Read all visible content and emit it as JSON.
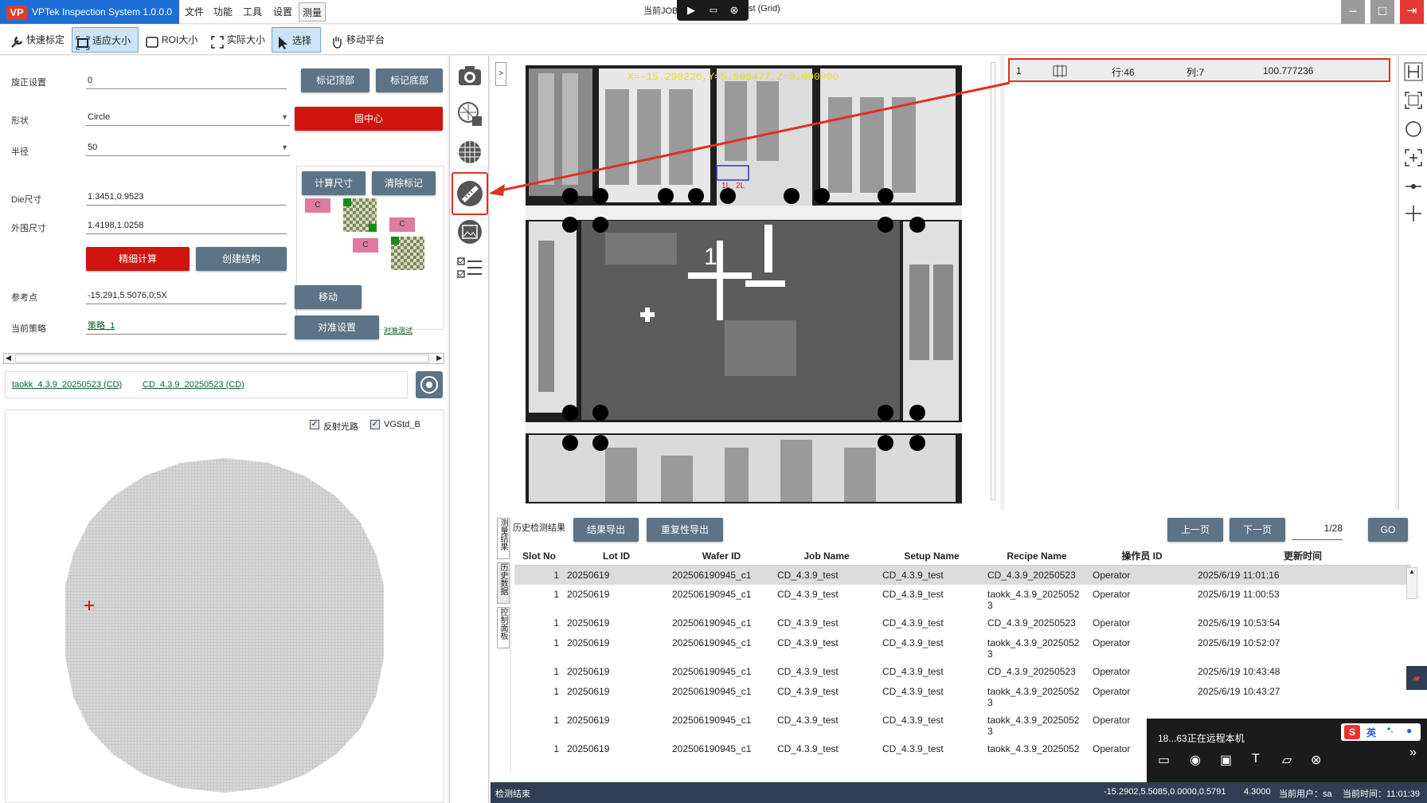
{
  "app": {
    "title": "VPTek Inspection System 1.0.0.0",
    "logo": "VP"
  },
  "menu": [
    "文件",
    "功能",
    "工具",
    "设置",
    "测量"
  ],
  "window_title": {
    "left": "当前JOB",
    "right": "st (Grid)"
  },
  "toolbar": {
    "items": [
      "快速标定",
      "适应大小",
      "ROI大小",
      "实际大小",
      "选择",
      "移动平台"
    ]
  },
  "form": {
    "rotate_label": "旋正设置",
    "rotate_value": "0",
    "mark_top": "标记顶部",
    "mark_bottom": "标记底部",
    "shape_label": "形状",
    "shape_value": "Circle",
    "circle_center": "圆中心",
    "radius_label": "半径",
    "radius_value": "50",
    "calc_size": "计算尺寸",
    "clear_mark": "清除标记",
    "die_label": "Die尺寸",
    "die_value": "1.3451,0.9523",
    "outer_label": "外围尺寸",
    "outer_value": "1.4198,1.0258",
    "fine_calc": "精细计算",
    "create_struct": "创建结构",
    "ref_label": "参考点",
    "ref_value": "-15.291,5.5076,0;5X",
    "move": "移动",
    "strategy_label": "当前策略",
    "strategy_value": "策略_1",
    "align_settings": "对准设置",
    "align_test": "对准测试",
    "tag_c": "C"
  },
  "recipes": {
    "link1": "taokk_4.3.9_20250523 (CD)",
    "link2": "CD_4.3.9_20250523 (CD)"
  },
  "wafer": {
    "check1": "反射光路",
    "check2": "VGStd_B"
  },
  "image": {
    "coord_text": "X=-15.290226,Y=5.508477,Z=0.000000",
    "expand": ">",
    "mark1": "1L",
    "mark2": "2L",
    "die_num": "1"
  },
  "result_row": {
    "index": "1",
    "row": "行:46",
    "col": "列:7",
    "value": "100.777236"
  },
  "history": {
    "title": "历史检测结果",
    "export": "结果导出",
    "repeat_export": "重复性导出",
    "prev": "上一页",
    "next": "下一页",
    "page": "1/28",
    "go": "GO",
    "vtabs": [
      "测量结果",
      "历史数据",
      "控制面板"
    ],
    "columns": [
      "Slot No",
      "Lot ID",
      "Wafer ID",
      "Job Name",
      "Setup Name",
      "Recipe Name",
      "操作员 ID",
      "更新时间"
    ],
    "rows": [
      [
        "1",
        "20250619",
        "202506190945_c1",
        "CD_4.3.9_test",
        "CD_4.3.9_test",
        "CD_4.3.9_20250523",
        "Operator",
        "2025/6/19 11:01:16"
      ],
      [
        "1",
        "20250619",
        "202506190945_c1",
        "CD_4.3.9_test",
        "CD_4.3.9_test",
        "taokk_4.3.9_2025052\n3",
        "Operator",
        "2025/6/19 11:00:53"
      ],
      [
        "1",
        "20250619",
        "202506190945_c1",
        "CD_4.3.9_test",
        "CD_4.3.9_test",
        "CD_4.3.9_20250523",
        "Operator",
        "2025/6/19 10:53:54"
      ],
      [
        "1",
        "20250619",
        "202506190945_c1",
        "CD_4.3.9_test",
        "CD_4.3.9_test",
        "taokk_4.3.9_2025052\n3",
        "Operator",
        "2025/6/19 10:52:07"
      ],
      [
        "1",
        "20250619",
        "202506190945_c1",
        "CD_4.3.9_test",
        "CD_4.3.9_test",
        "CD_4.3.9_20250523",
        "Operator",
        "2025/6/19 10:43:48"
      ],
      [
        "1",
        "20250619",
        "202506190945_c1",
        "CD_4.3.9_test",
        "CD_4.3.9_test",
        "taokk_4.3.9_2025052\n3",
        "Operator",
        "2025/6/19 10:43:27"
      ],
      [
        "1",
        "20250619",
        "202506190945_c1",
        "CD_4.3.9_test",
        "CD_4.3.9_test",
        "taokk_4.3.9_2025052\n3",
        "Operator",
        ""
      ],
      [
        "1",
        "20250619",
        "202506190945_c1",
        "CD_4.3.9_test",
        "CD_4.3.9_test",
        "taokk_4.3.9_2025052",
        "Operator",
        ""
      ]
    ]
  },
  "status": {
    "left": "检测结束",
    "coords": "-15.2902,5.5085,0.0000,0.5791",
    "zoom": "4.3000",
    "user": "当前用户：sa",
    "time": "当前时间：11:01:39"
  },
  "remote": {
    "text": "18...63正在远程本机",
    "ime": "英"
  }
}
